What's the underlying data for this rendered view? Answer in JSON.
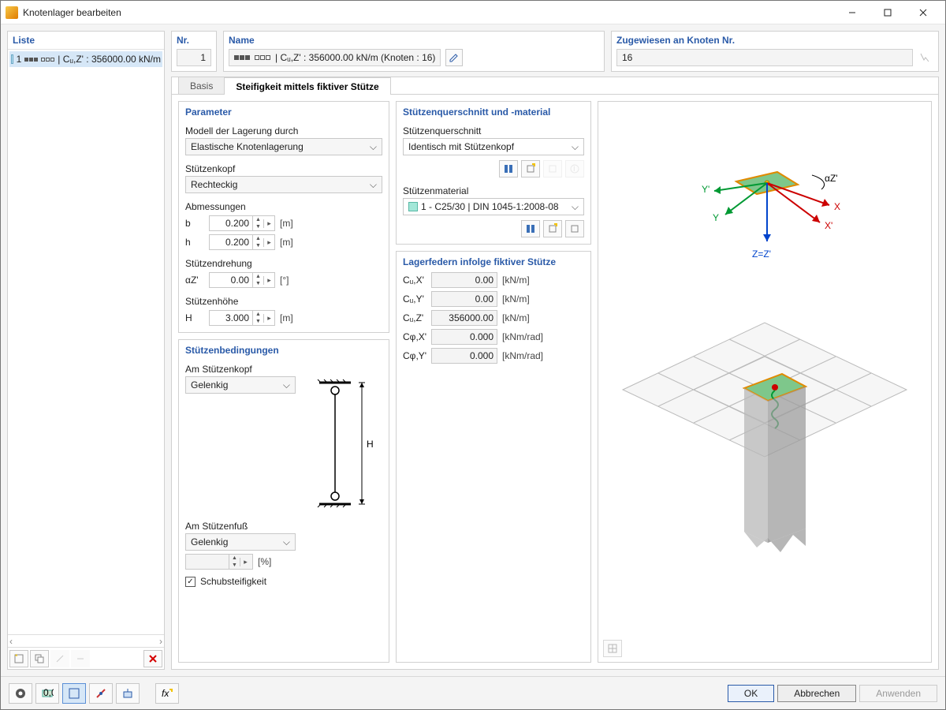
{
  "window": {
    "title": "Knotenlager bearbeiten"
  },
  "left": {
    "title": "Liste",
    "item_num": "1",
    "item_text": "| Cᵤ,Z' : 356000.00 kN/m"
  },
  "header": {
    "nr_label": "Nr.",
    "nr_value": "1",
    "name_label": "Name",
    "name_text": "| Cᵤ,Z' : 356000.00 kN/m (Knoten : 16)",
    "kn_label": "Zugewiesen an Knoten Nr.",
    "kn_value": "16"
  },
  "tabs": {
    "basis": "Basis",
    "stiff": "Steifigkeit mittels fiktiver Stütze"
  },
  "parameter": {
    "title": "Parameter",
    "model_label": "Modell der Lagerung durch",
    "model_value": "Elastische Knotenlagerung",
    "kopf_label": "Stützenkopf",
    "kopf_value": "Rechteckig",
    "abm_label": "Abmessungen",
    "b_label": "b",
    "b_value": "0.200",
    "b_unit": "[m]",
    "h_label": "h",
    "h_value": "0.200",
    "h_unit": "[m]",
    "rot_label": "Stützendrehung",
    "az_label": "αZ'",
    "az_value": "0.00",
    "az_unit": "[°]",
    "height_label": "Stützenhöhe",
    "H_label": "H",
    "H_value": "3.000",
    "H_unit": "[m]"
  },
  "conds": {
    "title": "Stützenbedingungen",
    "top_label": "Am Stützenkopf",
    "top_value": "Gelenkig",
    "bot_label": "Am Stützenfuß",
    "bot_value": "Gelenkig",
    "pct_unit": "[%]",
    "shear": "Schubsteifigkeit"
  },
  "cross": {
    "title": "Stützenquerschnitt und -material",
    "sec_label": "Stützenquerschnitt",
    "sec_value": "Identisch mit Stützenkopf",
    "mat_label": "Stützenmaterial",
    "mat_value": "1 - C25/30 | DIN 1045-1:2008-08"
  },
  "springs": {
    "title": "Lagerfedern infolge fiktiver Stütze",
    "rows": [
      {
        "l": "Cᵤ,X'",
        "v": "0.00",
        "u": "[kN/m]"
      },
      {
        "l": "Cᵤ,Y'",
        "v": "0.00",
        "u": "[kN/m]"
      },
      {
        "l": "Cᵤ,Z'",
        "v": "356000.00",
        "u": "[kN/m]"
      },
      {
        "l": "Cφ,X'",
        "v": "0.000",
        "u": "[kNm/rad]"
      },
      {
        "l": "Cφ,Y'",
        "v": "0.000",
        "u": "[kNm/rad]"
      }
    ]
  },
  "preview_labels": {
    "y1": "Y'",
    "y": "Y",
    "x": "X",
    "x1": "X'",
    "az": "αZ'",
    "z": "Z=Z'"
  },
  "footer": {
    "ok": "OK",
    "cancel": "Abbrechen",
    "apply": "Anwenden"
  }
}
